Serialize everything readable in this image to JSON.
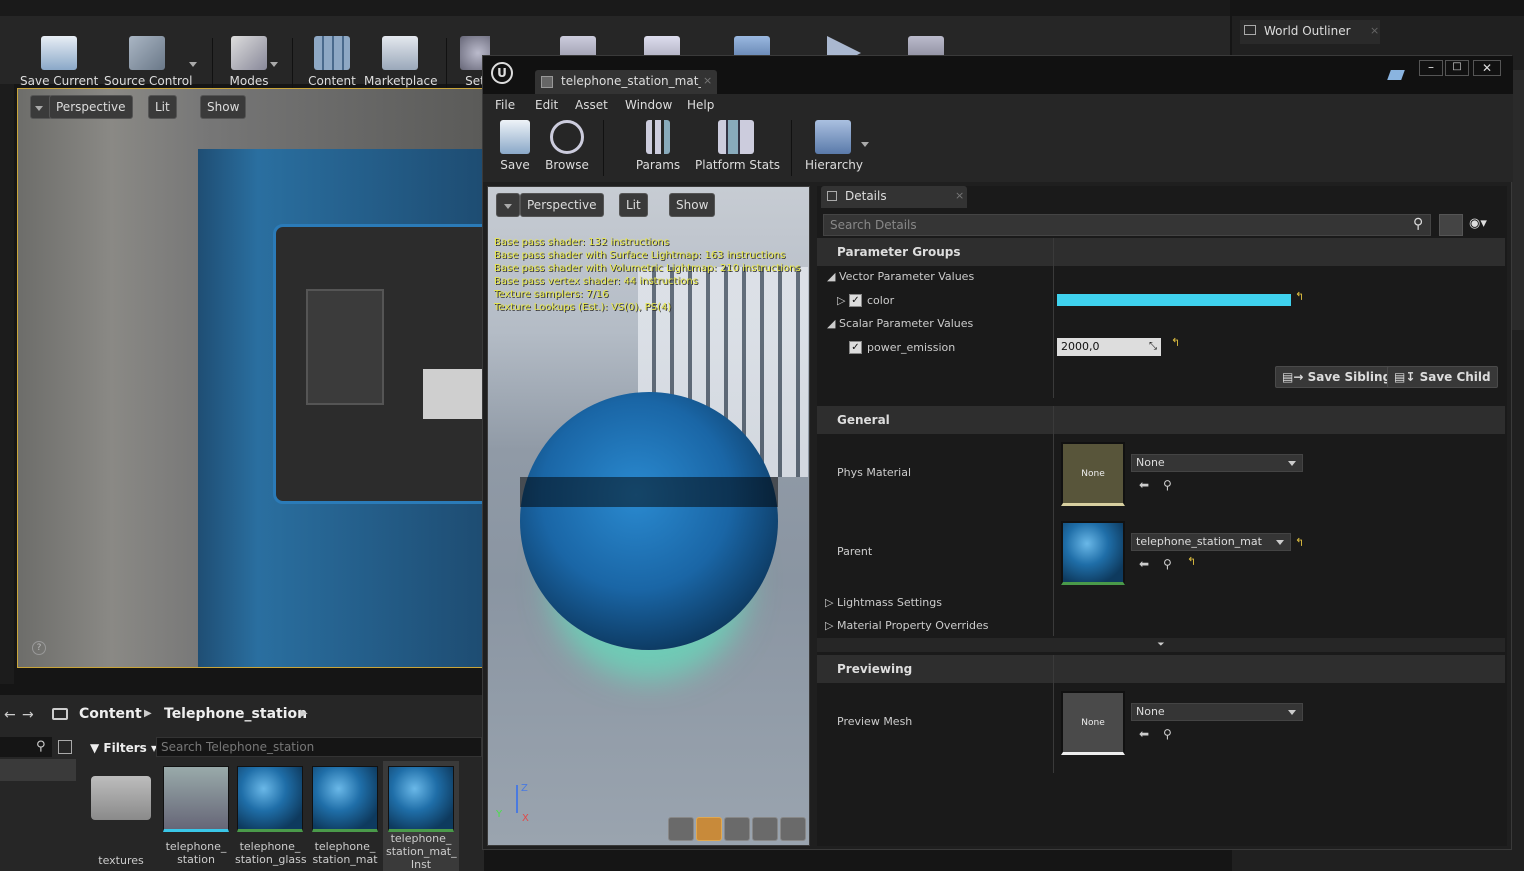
{
  "main_toolbar": {
    "save_current": "Save Current",
    "source_control": "Source Control",
    "modes": "Modes",
    "content": "Content",
    "marketplace": "Marketplace",
    "settings": "Set"
  },
  "main_viewport": {
    "perspective": "Perspective",
    "lit": "Lit",
    "show": "Show",
    "help": "?"
  },
  "content_browser": {
    "path": [
      "Content",
      "Telephone_station"
    ],
    "filters": "Filters",
    "search_placeholder": "Search Telephone_station",
    "assets": [
      {
        "name": "textures"
      },
      {
        "name": "telephone_ station"
      },
      {
        "name": "telephone_ station_glass"
      },
      {
        "name": "telephone_ station_mat"
      },
      {
        "name": "telephone_ station_mat_ Inst"
      }
    ]
  },
  "world_outliner": {
    "title": "World Outliner"
  },
  "material_editor": {
    "tab_title": "telephone_station_mat_In",
    "menu": [
      "File",
      "Edit",
      "Asset",
      "Window",
      "Help"
    ],
    "toolbar": {
      "save": "Save",
      "browse": "Browse",
      "params": "Params",
      "platform_stats": "Platform Stats",
      "hierarchy": "Hierarchy"
    },
    "preview": {
      "perspective": "Perspective",
      "lit": "Lit",
      "show": "Show",
      "stats": [
        "Base pass shader: 132 instructions",
        "Base pass shader with Surface Lightmap: 163 instructions",
        "Base pass shader with Volumetric Lightmap: 210 instructions",
        "Base pass vertex shader: 44 instructions",
        "Texture samplers: 7/16",
        "Texture Lookups (Est.): VS(0), PS(4)"
      ],
      "axis_z": "Z",
      "axis_y": "Y",
      "axis_x": "X"
    },
    "details": {
      "tab": "Details",
      "search_placeholder": "Search Details",
      "parameter_groups": "Parameter Groups",
      "vector_params": "Vector Parameter Values",
      "color_label": "color",
      "color_value": "#3fd2ee",
      "scalar_params": "Scalar Parameter Values",
      "power_emission_label": "power_emission",
      "power_emission_value": "2000,0",
      "save_sibling": "Save Sibling",
      "save_child": "Save Child",
      "general": "General",
      "phys_material": "Phys Material",
      "phys_material_thumb": "None",
      "phys_material_value": "None",
      "parent": "Parent",
      "parent_value": "telephone_station_mat",
      "lightmass": "Lightmass Settings",
      "material_overrides": "Material Property Overrides",
      "previewing": "Previewing",
      "preview_mesh": "Preview Mesh",
      "preview_mesh_thumb": "None",
      "preview_mesh_value": "None"
    }
  }
}
